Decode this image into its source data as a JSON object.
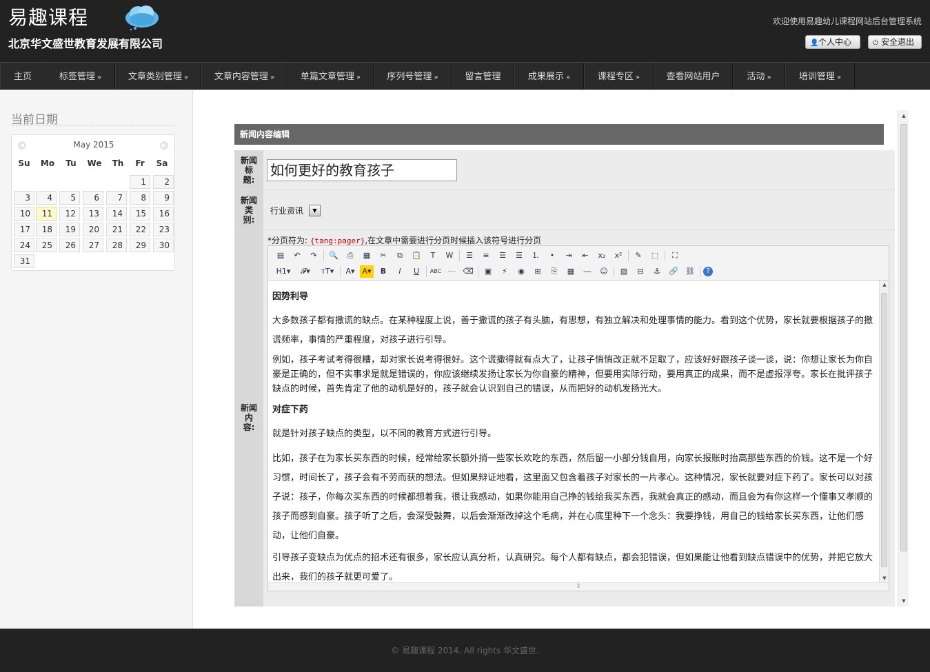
{
  "header": {
    "logo_text": "易趣课程",
    "company": "北京华文盛世教育发展有限公司",
    "welcome": "欢迎使用易趣幼儿课程网站后台管理系统",
    "profile_label": "个人中心",
    "logout_label": "安全退出"
  },
  "nav": {
    "items": [
      {
        "label": "主页",
        "arrow": ""
      },
      {
        "label": "标签管理",
        "arrow": "»"
      },
      {
        "label": "文章类别管理",
        "arrow": "»"
      },
      {
        "label": "文章内容管理",
        "arrow": "»"
      },
      {
        "label": "单篇文章管理",
        "arrow": "»"
      },
      {
        "label": "序列号管理",
        "arrow": "»"
      },
      {
        "label": "留言管理",
        "arrow": ""
      },
      {
        "label": "成果展示",
        "arrow": "»"
      },
      {
        "label": "课程专区",
        "arrow": "»"
      },
      {
        "label": "查看网站用户",
        "arrow": ""
      },
      {
        "label": "活动",
        "arrow": "»"
      },
      {
        "label": "培训管理",
        "arrow": "»"
      }
    ]
  },
  "sidebar": {
    "title": "当前日期",
    "calendar": {
      "month_label": "May 2015",
      "weekdays": [
        "Su",
        "Mo",
        "Tu",
        "We",
        "Th",
        "Fr",
        "Sa"
      ],
      "days": [
        "1",
        "2",
        "3",
        "4",
        "5",
        "6",
        "7",
        "8",
        "9",
        "10",
        "11",
        "12",
        "13",
        "14",
        "15",
        "16",
        "17",
        "18",
        "19",
        "20",
        "21",
        "22",
        "23",
        "24",
        "25",
        "26",
        "27",
        "28",
        "29",
        "30",
        "31"
      ],
      "today": "11"
    }
  },
  "main": {
    "panel_title": "新闻内容编辑",
    "labels": {
      "title_1": "新闻",
      "title_2": "标",
      "title_3": "题:",
      "type_1": "新闻",
      "type_2": "类",
      "type_3": "别:",
      "content_1": "新闻",
      "content_2": "内",
      "content_3": "容:"
    },
    "news_title": "如何更好的教育孩子",
    "news_type": "行业资讯",
    "hint_prefix": "*分页符为:",
    "hint_code": "{tang:pager}",
    "hint_suffix": ",在文章中需要进行分页时候插入该符号进行分页",
    "toolbar_row1": [
      "source",
      "undo",
      "redo",
      "preview",
      "print",
      "template",
      "cut",
      "copy",
      "paste",
      "paste-text",
      "paste-word",
      "align-left",
      "align-center",
      "align-right",
      "justify",
      "ordered-list",
      "unordered-list",
      "indent",
      "outdent",
      "subscript",
      "superscript",
      "clear-format",
      "select-all",
      "fullscreen"
    ],
    "toolbar_row2": [
      "H1",
      "font",
      "TT",
      "A",
      "A",
      "B",
      "I",
      "U",
      "ABC",
      "grid",
      "eraser",
      "image",
      "flash",
      "media",
      "insert",
      "attach",
      "table",
      "hr",
      "emoticon",
      "img",
      "page-break",
      "anchor",
      "link",
      "unlink",
      "help"
    ],
    "content": {
      "h1": "因势利导",
      "p1": "大多数孩子都有撒谎的缺点。在某种程度上说，善于撒谎的孩子有头脑，有思想，有独立解决和处理事情的能力。看到这个优势，家长就要根据孩子的撒谎频率，事情的严重程度，对孩子进行引导。",
      "p2": "例如，孩子考试考得很糟，却对家长说考得很好。这个谎撒得就有点大了，让孩子悄悄改正就不足取了，应该好好跟孩子谈一谈，说：你想让家长为你自豪是正确的，但不实事求是就是错误的，你应该继续发扬让家长为你自豪的精神，但要用实际行动，要用真正的成果，而不是虚报浮夸。家长在批评孩子缺点的时候，首先肯定了他的动机是好的，孩子就会认识到自己的错误，从而把好的动机发扬光大。",
      "h2": "对症下药",
      "p3": "就是针对孩子缺点的类型，以不同的教育方式进行引导。",
      "p4": "比如，孩子在为家长买东西的时候，经常给家长额外捎一些家长欢吃的东西，然后留一小部分钱自用，向家长报账时抬高那些东西的价钱。这不是一个好习惯，时间长了，孩子会有不劳而获的想法。但如果辩证地看，这里面又包含着孩子对家长的一片孝心。这种情况，家长就要对症下药了。家长可以对孩子说：孩子，你每次买东西的时候都想着我，很让我感动，如果你能用自己挣的钱给我买东西，我就会真正的感动，而且会为有你这样一个懂事又孝顺的孩子而感到自豪。孩子听了之后，会深受鼓舞，以后会渐渐改掉这个毛病，并在心底里种下一个念头：我要挣钱，用自己的钱给家长买东西，让他们感动，让他们自豪。",
      "p5": "引导孩子变缺点为优点的招术还有很多，家长应认真分析，认真研究。每个人都有缺点，都会犯错误，但如果能让他看到缺点错误中的优势，并把它放大出来，我们的孩子就更可爱了。"
    }
  },
  "footer": {
    "text": "© 易趣课程 2014. All rights 华文盛世."
  }
}
